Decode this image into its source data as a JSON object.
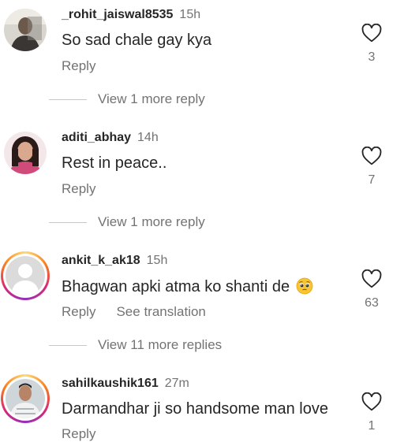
{
  "comments": [
    {
      "username": "_rohit_jaiswal8535",
      "time": "15h",
      "text": "So sad chale gay kya",
      "reply_label": "Reply",
      "likes": "3",
      "view_more": "View 1 more reply"
    },
    {
      "username": "aditi_abhay",
      "time": "14h",
      "text": "Rest in peace..",
      "reply_label": "Reply",
      "likes": "7",
      "view_more": "View 1 more reply"
    },
    {
      "username": "ankit_k_ak18",
      "time": "15h",
      "text": "Bhagwan apki atma ko shanti de",
      "emoji": "pleading-face-emoji",
      "reply_label": "Reply",
      "see_translation": "See translation",
      "likes": "63",
      "view_more": "View 11 more replies"
    },
    {
      "username": "sahilkaushik161",
      "time": "27m",
      "text": "Darmandhar ji so handsome man love",
      "reply_label": "Reply",
      "likes": "1"
    }
  ],
  "icons": {
    "like": "heart-outline-icon"
  },
  "colors": {
    "primary_text": "#262626",
    "secondary_text": "#737373",
    "story_ring": "#d62976"
  }
}
